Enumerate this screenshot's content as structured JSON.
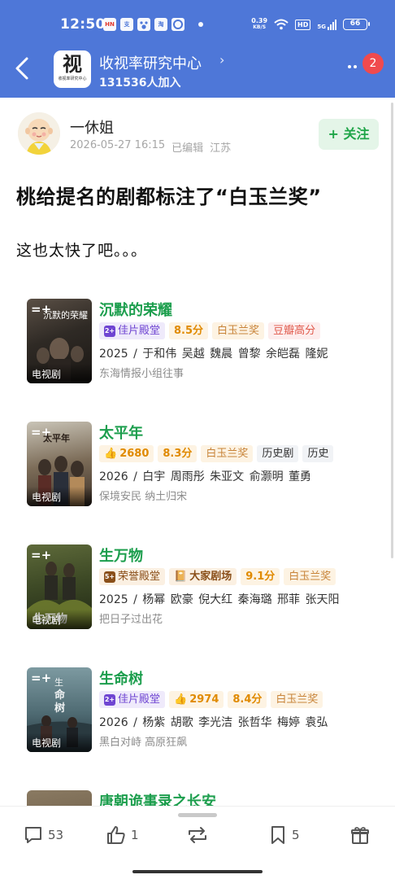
{
  "status_bar": {
    "time": "12:50",
    "app_icons": [
      "news-app-icon",
      "alipay-icon",
      "baidu-icon",
      "taobao-icon",
      "browser-icon"
    ],
    "app_icon_labels": [
      "HN",
      "支",
      "",
      "淘",
      ""
    ],
    "net_speed_value": "0.39",
    "net_speed_unit": "KB/S",
    "hd_label": "HD",
    "signal_label": "5G",
    "battery": "66"
  },
  "header": {
    "group_name": "收视率研究中心",
    "member_count": "131536人加入",
    "notification_count": "2",
    "avatar_char": "视",
    "avatar_caption": "收视率研究中心"
  },
  "post": {
    "author": "一休姐",
    "date": "2026-05-27 16:15",
    "edited": "已编辑",
    "location": "江苏",
    "follow_label": "+ 关注",
    "title": "桃给提名的剧都标注了“白玉兰奖”",
    "body": "这也太快了吧。。。"
  },
  "dramas": [
    {
      "title": "沉默的荣耀",
      "poster_title": "沉默的荣耀",
      "poster_tag": "电视剧",
      "badge": "佳片殿堂",
      "badge_icon": "2+",
      "score": "8.5分",
      "award": "白玉兰奖",
      "extra": "豆瓣高分",
      "cast": "2025 / 于和伟  吴越  魏晨  曾黎  余皑磊  隆妮",
      "tagline": "东海情报小组往事"
    },
    {
      "title": "太平年",
      "poster_title": "太平年",
      "poster_tag": "电视剧",
      "heat": "2680",
      "score": "8.3分",
      "award": "白玉兰奖",
      "genres": [
        "历史剧",
        "历史"
      ],
      "cast": "2026 / 白宇  周雨彤  朱亚文  俞灏明  董勇",
      "tagline": "保境安民 纳土归宋"
    },
    {
      "title": "生万物",
      "poster_title": "生万物",
      "poster_tag": "电视剧",
      "badge": "荣誉殿堂",
      "badge_icon": "5+",
      "platform": "大家剧场",
      "score": "9.1分",
      "award": "白玉兰奖",
      "cast": "2025 / 杨幂  欧豪  倪大红  秦海璐  邢菲  张天阳",
      "tagline": "把日子过出花"
    },
    {
      "title": "生命树",
      "poster_title": "生命树",
      "poster_tag": "电视剧",
      "badge": "佳片殿堂",
      "badge_icon": "2+",
      "heat": "2974",
      "score": "8.4分",
      "award": "白玉兰奖",
      "cast": "2026 / 杨紫  胡歌  李光洁  张哲华  梅婷  袁弘",
      "tagline": "黑白对峙 高原狂飙"
    },
    {
      "title": "唐朝诡事录之长安",
      "poster_title": "",
      "poster_tag": ""
    }
  ],
  "actions": {
    "comments": "53",
    "likes": "1",
    "reposts": "",
    "favorites": "5"
  },
  "colors": {
    "header_blue": "#4e77d8",
    "drama_green": "#1c9e4d",
    "follow_green": "#1fa548",
    "badge_red": "#f04a4e"
  }
}
